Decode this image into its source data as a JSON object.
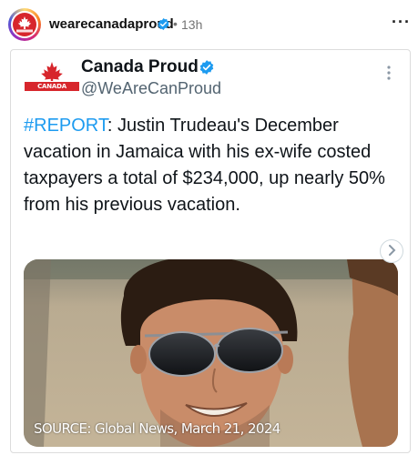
{
  "post": {
    "author": "wearecanadaproud",
    "separator": "•",
    "timestamp": "13h",
    "more_label": "···"
  },
  "tweet": {
    "display_name": "Canada Proud",
    "handle": "@WeAreCanProud",
    "logo_text": "CANADA PROUD",
    "hashtag": "#REPORT",
    "body": ": Justin Trudeau's December vacation in Jamaica with his ex-wife costed taxpayers a total of $234,000, up nearly 50% from his previous vacation.",
    "more_label": "⋮"
  },
  "media": {
    "caption": "SOURCE: Global News, March 21, 2024",
    "next_icon": "chevron-right-icon"
  },
  "colors": {
    "link_blue": "#1d9bf0",
    "verified_blue": "#1d9bf0",
    "brand_red": "#d7262c"
  }
}
